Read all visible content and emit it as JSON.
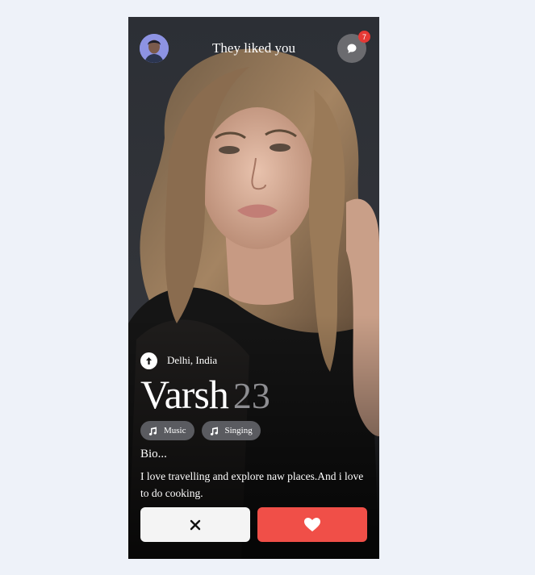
{
  "header": {
    "title": "They liked you",
    "unread_count": "7"
  },
  "profile": {
    "location": "Delhi, India",
    "name": "Varsh",
    "age": "23",
    "interests": [
      "Music",
      "Singing"
    ],
    "bio_title": "Bio...",
    "bio_text": "I love travelling and explore naw places.And i love to do cooking."
  },
  "icons": {
    "avatar": "user-avatar",
    "chat": "chat-bubble-icon",
    "location": "location-arrow-icon",
    "interest": "music-note-icon",
    "dislike": "close-icon",
    "like": "heart-icon"
  },
  "colors": {
    "like": "#f04f48",
    "badge": "#e53935",
    "dislike_bg": "#f4f4f4"
  }
}
